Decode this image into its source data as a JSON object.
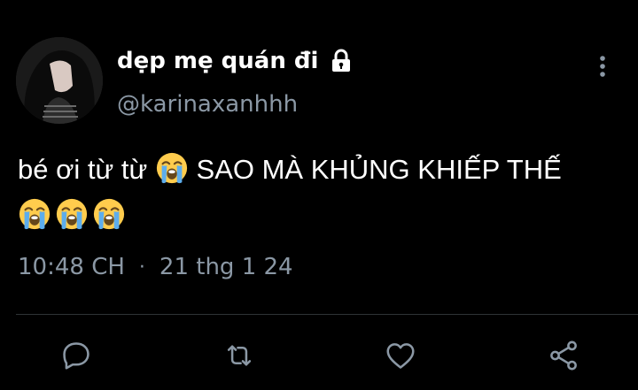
{
  "tweet": {
    "display_name": "dẹp mẹ quán đi",
    "handle": "@karinaxanhhh",
    "text_line1": "bé ơi từ từ",
    "text_line1_after": "SAO MÀ KHỦNG KHIẾP THẾ",
    "time": "10:48 CH",
    "separator": "·",
    "date": "21 thg 1 24",
    "emoji_name": "loudly-crying-face"
  },
  "icons": {
    "lock": "lock-icon",
    "more": "more-vertical-icon",
    "reply": "reply-icon",
    "retweet": "retweet-icon",
    "like": "heart-icon",
    "share": "share-icon"
  },
  "colors": {
    "background": "#000000",
    "text": "#ffffff",
    "secondary": "#8b98a5",
    "divider": "#2f3336"
  }
}
